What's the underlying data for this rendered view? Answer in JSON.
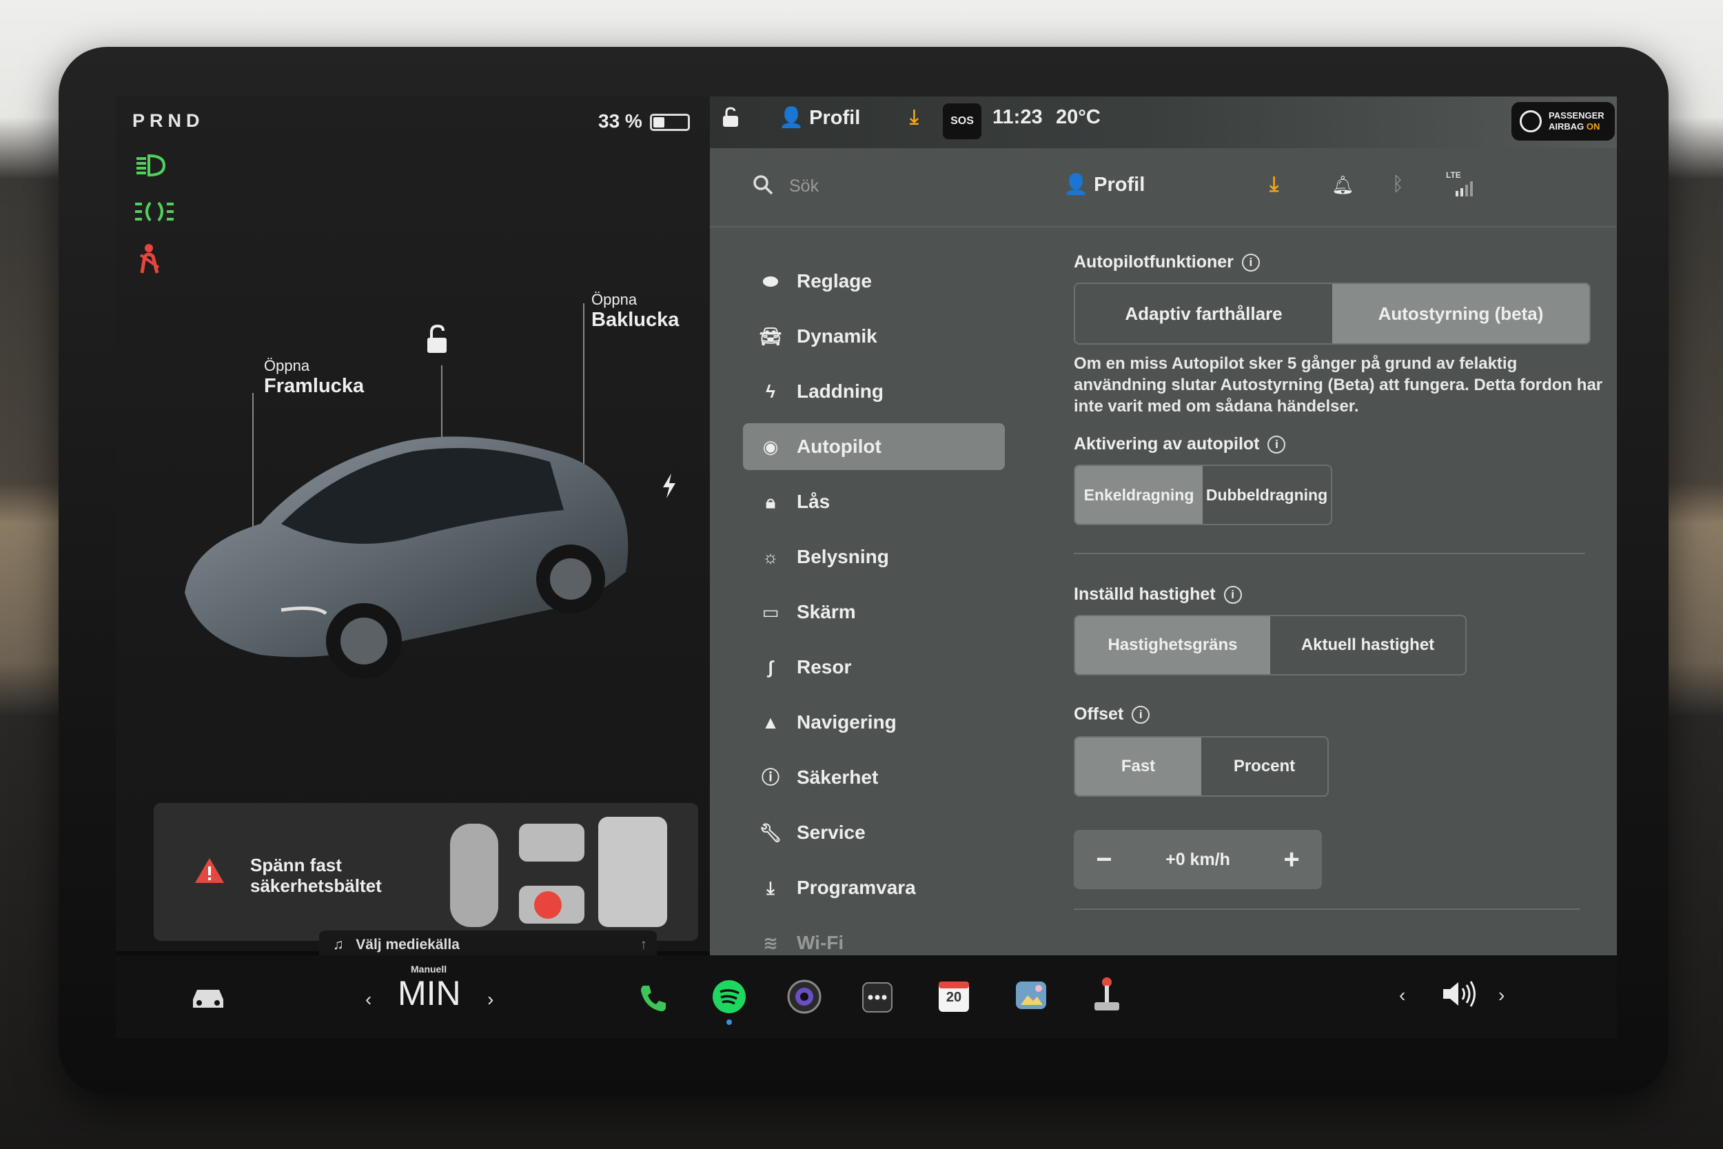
{
  "left_panel": {
    "gear": "PRND",
    "battery_percent": "33 %",
    "battery_level": 0.33,
    "frunk": {
      "small": "Öppna",
      "big": "Framlucka"
    },
    "trunk": {
      "small": "Öppna",
      "big": "Baklucka"
    },
    "seatbelt_alert": "Spänn fast säkerhetsbältet",
    "media_source": "Välj mediekälla"
  },
  "status_bar": {
    "profile": "Profil",
    "sos": "SOS",
    "time": "11:23",
    "temperature": "20°C",
    "airbag_line1": "PASSENGER",
    "airbag_line2": "AIRBAG",
    "airbag_state": "ON"
  },
  "search": {
    "placeholder": "Sök",
    "profile": "Profil",
    "network": "LTE"
  },
  "menu": [
    {
      "label": "Reglage",
      "icon": "toggle-icon"
    },
    {
      "label": "Dynamik",
      "icon": "car-icon"
    },
    {
      "label": "Laddning",
      "icon": "bolt-icon"
    },
    {
      "label": "Autopilot",
      "icon": "steering-wheel-icon",
      "selected": true
    },
    {
      "label": "Lås",
      "icon": "lock-icon"
    },
    {
      "label": "Belysning",
      "icon": "sun-icon"
    },
    {
      "label": "Skärm",
      "icon": "display-icon"
    },
    {
      "label": "Resor",
      "icon": "trips-icon"
    },
    {
      "label": "Navigering",
      "icon": "navigation-icon"
    },
    {
      "label": "Säkerhet",
      "icon": "safety-icon"
    },
    {
      "label": "Service",
      "icon": "wrench-icon"
    },
    {
      "label": "Programvara",
      "icon": "download-icon"
    },
    {
      "label": "Wi-Fi",
      "icon": "wifi-icon"
    }
  ],
  "content": {
    "autopilot_features": {
      "title": "Autopilotfunktioner",
      "options": [
        "Adaptiv farthållare",
        "Autostyrning (beta)"
      ],
      "selected": 1,
      "description": "Om en miss Autopilot sker 5 gånger på grund av felaktig användning slutar Autostyrning (Beta) att fungera. Detta fordon har inte varit med om sådana händelser."
    },
    "activation": {
      "title": "Aktivering av autopilot",
      "options": [
        "Enkeldragning",
        "Dubbeldragning"
      ],
      "selected": 0
    },
    "set_speed": {
      "title": "Inställd hastighet",
      "options": [
        "Hastighetsgräns",
        "Aktuell hastighet"
      ],
      "selected": 0
    },
    "offset": {
      "title": "Offset",
      "options": [
        "Fast",
        "Procent"
      ],
      "selected": 0,
      "minus": "−",
      "value": "+0 km/h",
      "plus": "+"
    }
  },
  "taskbar": {
    "climate_mode": "Manuell",
    "climate_value": "MIN",
    "calendar_day": "20"
  },
  "colors": {
    "green_indicator": "#4fd25a",
    "red_indicator": "#e8453c",
    "spotify": "#1ed760",
    "phone": "#3fc45a",
    "warning": "#e34a3f",
    "accent_orange": "#f2a51a"
  }
}
